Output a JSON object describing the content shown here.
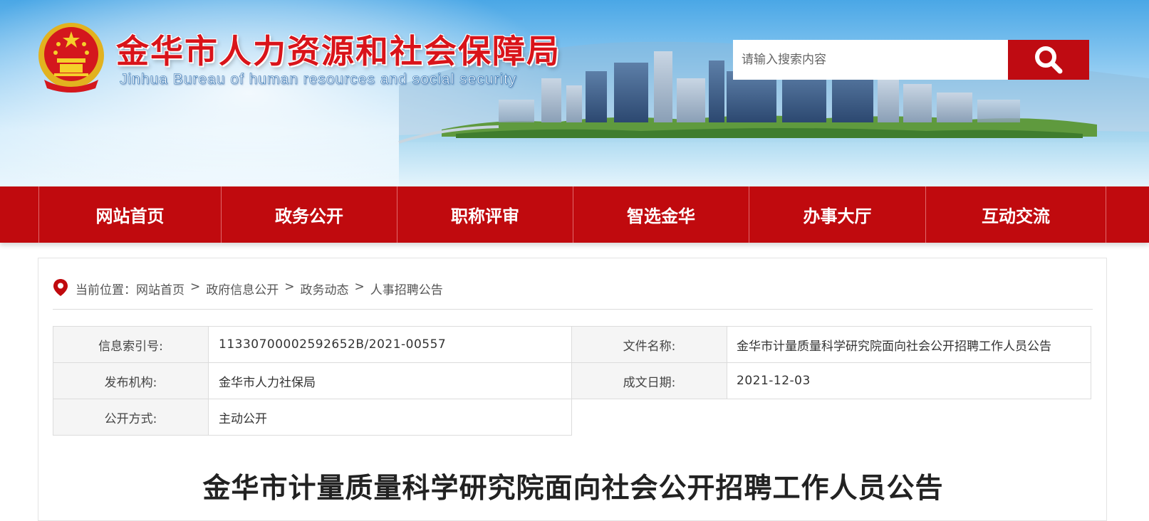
{
  "header": {
    "site_title": "金华市人力资源和社会保障局",
    "site_subtitle": "Jinhua Bureau of human resources and social security",
    "search_placeholder": "请输入搜索内容",
    "accent_color": "#c00a0e"
  },
  "nav": {
    "items": [
      {
        "label": "网站首页"
      },
      {
        "label": "政务公开"
      },
      {
        "label": "职称评审"
      },
      {
        "label": "智选金华"
      },
      {
        "label": "办事大厅"
      },
      {
        "label": "互动交流"
      }
    ]
  },
  "breadcrumb": {
    "prefix": "当前位置：",
    "items": [
      "网站首页",
      "政府信息公开",
      "政务动态",
      "人事招聘公告"
    ],
    "separator": ">"
  },
  "meta": {
    "index_label": "信息索引号:",
    "index_value": "11330700002592652B/2021-00557",
    "doc_name_label": "文件名称:",
    "doc_name_value": "金华市计量质量科学研究院面向社会公开招聘工作人员公告",
    "publisher_label": "发布机构:",
    "publisher_value": "金华市人力社保局",
    "date_label": "成文日期:",
    "date_value": "2021-12-03",
    "disclosure_label": "公开方式:",
    "disclosure_value": "主动公开"
  },
  "article": {
    "title": "金华市计量质量科学研究院面向社会公开招聘工作人员公告"
  }
}
